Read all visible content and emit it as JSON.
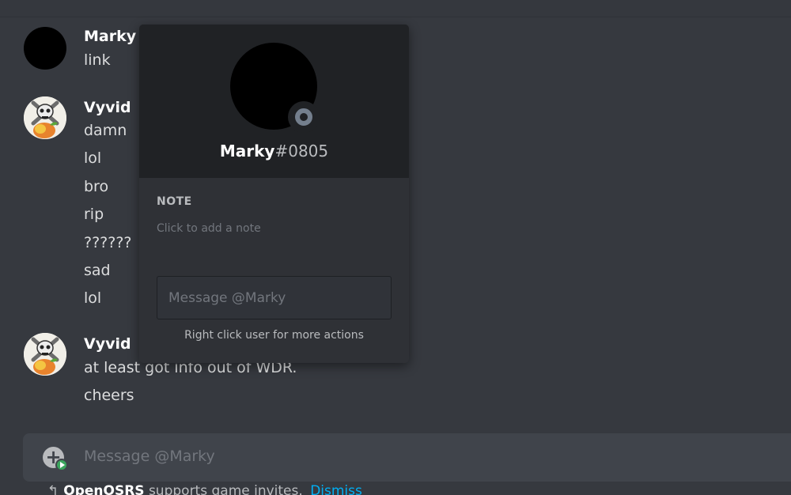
{
  "messages": [
    {
      "author": "Marky",
      "avatar": "black-avatar",
      "lines": [
        "link"
      ]
    },
    {
      "author": "Vyvid",
      "avatar": "skull-avatar",
      "lines": [
        "damn",
        "lol",
        "bro",
        "rip",
        "??????",
        "sad",
        "lol"
      ]
    },
    {
      "author": "Vyvid",
      "avatar": "skull-avatar",
      "lines": [
        "at least got info out of WDR.",
        "cheers"
      ]
    }
  ],
  "popout": {
    "username": "Marky",
    "discriminator": "#0805",
    "status": "offline",
    "note_title": "NOTE",
    "note_placeholder": "Click to add a note",
    "message_placeholder": "Message @Marky",
    "hint": "Right click user for more actions"
  },
  "composer": {
    "placeholder": "Message @Marky",
    "add_icon": "plus-icon",
    "badge_icon": "play-badge-icon"
  },
  "invite_bar": {
    "app_name": "OpenOSRS",
    "text": "supports game invites.",
    "dismiss": "Dismiss"
  },
  "colors": {
    "background": "#36393f",
    "popout_header": "#202225",
    "popout_body": "#2f3136",
    "composer": "#40444b",
    "link": "#00aff4",
    "status_offline": "#747f8d"
  }
}
